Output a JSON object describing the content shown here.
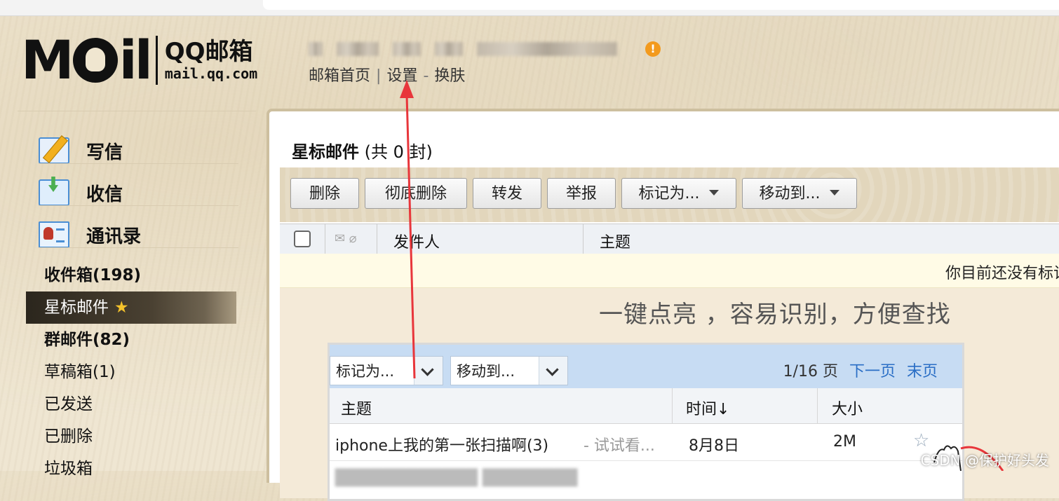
{
  "logo": {
    "mail": "M",
    "mail_rest": "il",
    "qq": "QQ邮箱",
    "domain": "mail.qq.com"
  },
  "header": {
    "links": [
      "邮箱首页",
      "设置",
      "换肤"
    ],
    "sep1": "|",
    "sep2": "-"
  },
  "sidebar": {
    "actions": [
      {
        "label": "写信",
        "icon": "compose-icon"
      },
      {
        "label": "收信",
        "icon": "inbox-icon"
      },
      {
        "label": "通讯录",
        "icon": "contacts-icon"
      }
    ],
    "folders": [
      {
        "label": "收件箱(198)",
        "bold": true
      },
      {
        "label": "星标邮件",
        "active": true,
        "star": "★"
      },
      {
        "label": "群邮件(82)",
        "bold": true
      },
      {
        "label": "草稿箱(1)"
      },
      {
        "label": "已发送"
      },
      {
        "label": "已删除"
      },
      {
        "label": "垃圾箱"
      }
    ]
  },
  "main": {
    "title": "星标邮件",
    "count_text": "(共 0 封)",
    "toolbar": [
      "删除",
      "彻底删除",
      "转发",
      "举报",
      "标记为...",
      "移动到..."
    ],
    "columns": {
      "sender": "发件人",
      "subject": "主题"
    },
    "notice": "你目前还没有标记",
    "promo_heading": "一键点亮 ，容易识别，方便查找",
    "demo": {
      "mark_select": "标记为...",
      "move_select": "移动到...",
      "page_info": "1/16 页",
      "next_page": "下一页",
      "last_page": "末页",
      "col_subject": "主题",
      "col_time": "时间↓",
      "col_size": "大小",
      "row_subject": "iphone上我的第一张扫描啊(3)",
      "row_preview": "- 试试看...",
      "row_time": "8月8日",
      "row_size": "2M",
      "row_star": "☆"
    }
  },
  "warning_badge": "!",
  "watermark": "CSDN @保护好头发",
  "colors": {
    "accent_link": "#2a6ec5",
    "warning": "#f39a1d",
    "arrow": "#e8363b",
    "active_folder_bg": "#2b261d"
  }
}
